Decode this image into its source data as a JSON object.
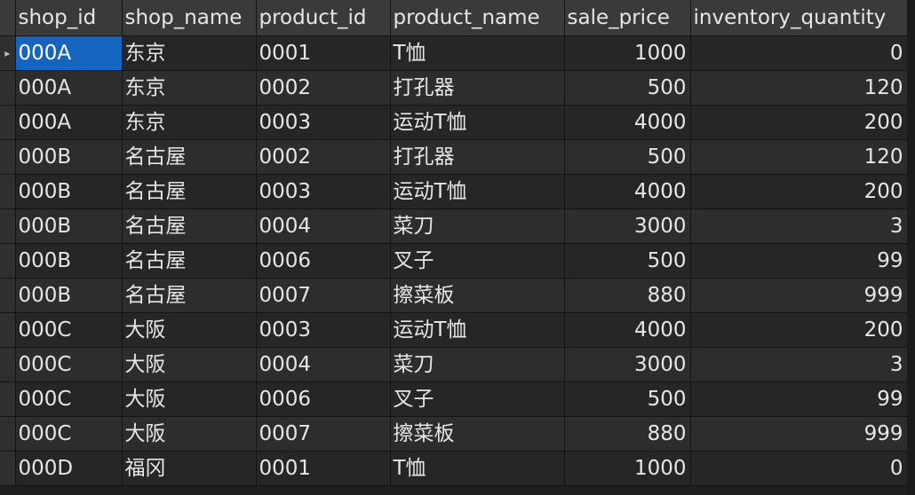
{
  "grid": {
    "columns": [
      "shop_id",
      "shop_name",
      "product_id",
      "product_name",
      "sale_price",
      "inventory_quantity"
    ],
    "current_row_marker": "▸",
    "rows": [
      [
        "000A",
        "东京",
        "0001",
        "T恤",
        "1000",
        "0"
      ],
      [
        "000A",
        "东京",
        "0002",
        "打孔器",
        "500",
        "120"
      ],
      [
        "000A",
        "东京",
        "0003",
        "运动T恤",
        "4000",
        "200"
      ],
      [
        "000B",
        "名古屋",
        "0002",
        "打孔器",
        "500",
        "120"
      ],
      [
        "000B",
        "名古屋",
        "0003",
        "运动T恤",
        "4000",
        "200"
      ],
      [
        "000B",
        "名古屋",
        "0004",
        "菜刀",
        "3000",
        "3"
      ],
      [
        "000B",
        "名古屋",
        "0006",
        "叉子",
        "500",
        "99"
      ],
      [
        "000B",
        "名古屋",
        "0007",
        "擦菜板",
        "880",
        "999"
      ],
      [
        "000C",
        "大阪",
        "0003",
        "运动T恤",
        "4000",
        "200"
      ],
      [
        "000C",
        "大阪",
        "0004",
        "菜刀",
        "3000",
        "3"
      ],
      [
        "000C",
        "大阪",
        "0006",
        "叉子",
        "500",
        "99"
      ],
      [
        "000C",
        "大阪",
        "0007",
        "擦菜板",
        "880",
        "999"
      ],
      [
        "000D",
        "福冈",
        "0001",
        "T恤",
        "1000",
        "0"
      ]
    ]
  },
  "colors": {
    "header_bg": "#3a3a3a",
    "row_bg": "#262626",
    "row_alt_bg": "#2d2d2d",
    "selection": "#1565c0"
  }
}
